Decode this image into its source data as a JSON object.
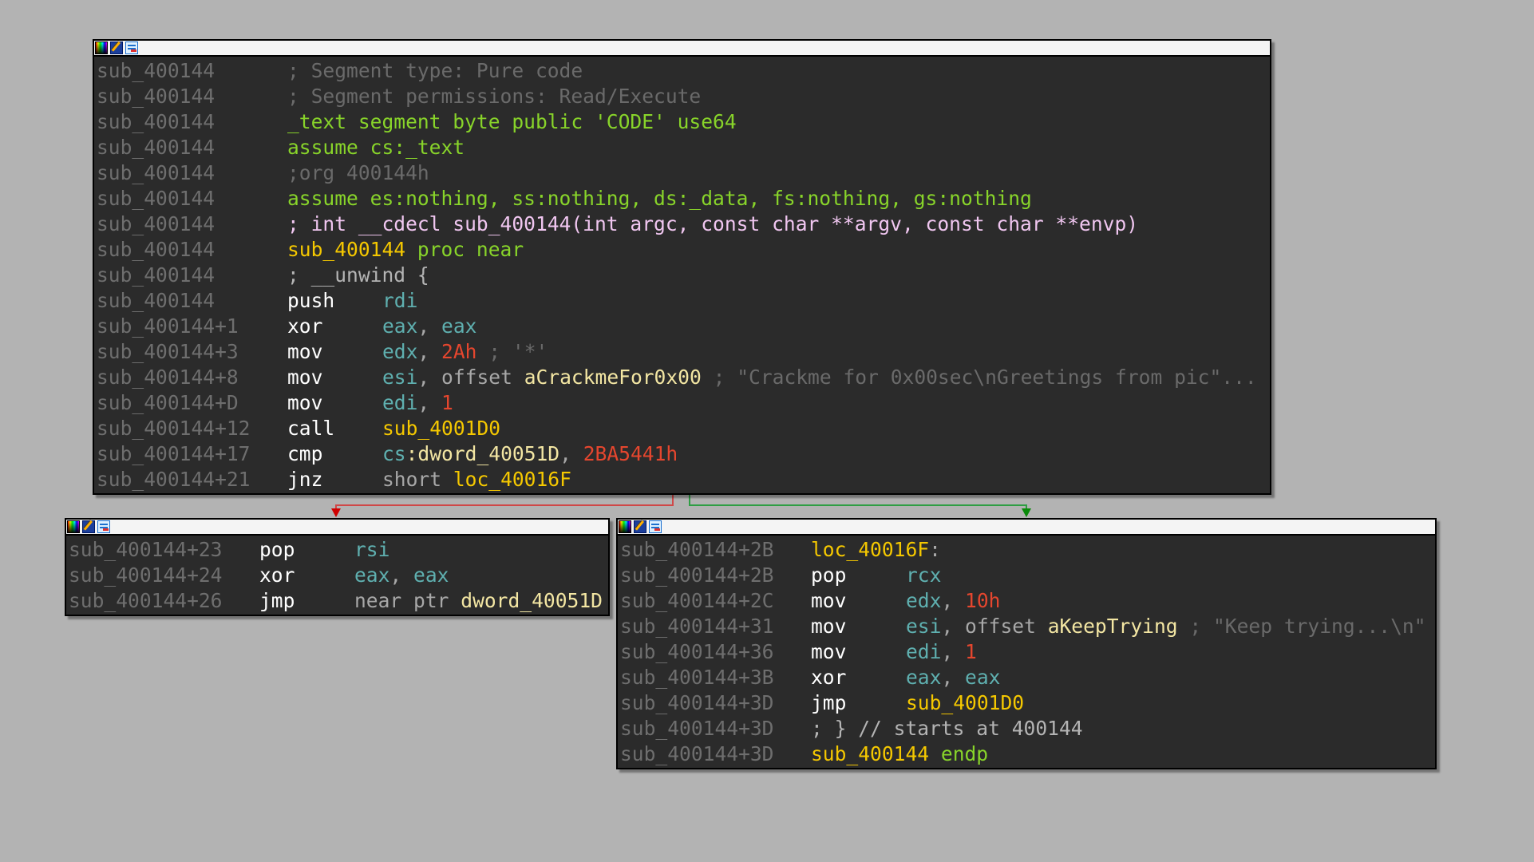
{
  "view": "IDA graph view",
  "colors": {
    "background": "#b3b3b3",
    "node_background": "#2b2b2b",
    "edge_false": "#d04848",
    "edge_true": "#2f9e44"
  },
  "node_header_icons": [
    "color-palette-icon",
    "edit-node-icon",
    "graph-view-icon"
  ],
  "nodes": {
    "main": {
      "lines": [
        {
          "addr": "sub_400144",
          "parts": [
            {
              "t": "; Segment type: Pure code",
              "c": "cmt"
            }
          ]
        },
        {
          "addr": "sub_400144",
          "parts": [
            {
              "t": "; Segment permissions: Read/Execute",
              "c": "cmt"
            }
          ]
        },
        {
          "addr": "sub_400144",
          "parts": [
            {
              "t": "_text segment byte public 'CODE' use64",
              "c": "seg"
            }
          ]
        },
        {
          "addr": "sub_400144",
          "parts": [
            {
              "t": "assume cs:_text",
              "c": "seg"
            }
          ]
        },
        {
          "addr": "sub_400144",
          "parts": [
            {
              "t": ";org 400144h",
              "c": "cmt"
            }
          ]
        },
        {
          "addr": "sub_400144",
          "parts": [
            {
              "t": "assume es:nothing, ss:nothing, ds:_data, fs:nothing, gs:nothing",
              "c": "seg"
            }
          ]
        },
        {
          "addr": "sub_400144",
          "parts": [
            {
              "t": "; int __cdecl sub_400144(int argc, const char **argv, const char **envp)",
              "c": "sig"
            }
          ]
        },
        {
          "addr": "sub_400144",
          "parts": [
            {
              "t": "sub_400144",
              "c": "lbl"
            },
            {
              "t": " proc near",
              "c": "seg"
            }
          ]
        },
        {
          "addr": "sub_400144",
          "parts": [
            {
              "t": "; __unwind {",
              "c": "lightcmt"
            }
          ]
        },
        {
          "addr": "sub_400144",
          "mnemonic": "push",
          "parts": [
            {
              "t": "rdi",
              "c": "reg"
            }
          ]
        },
        {
          "addr": "sub_400144+1",
          "mnemonic": "xor",
          "parts": [
            {
              "t": "eax",
              "c": "reg"
            },
            {
              "t": ", ",
              "c": "kw"
            },
            {
              "t": "eax",
              "c": "reg"
            }
          ]
        },
        {
          "addr": "sub_400144+3",
          "mnemonic": "mov",
          "parts": [
            {
              "t": "edx",
              "c": "reg"
            },
            {
              "t": ", ",
              "c": "kw"
            },
            {
              "t": "2Ah",
              "c": "num"
            },
            {
              "t": " ; '*'",
              "c": "cmt"
            }
          ]
        },
        {
          "addr": "sub_400144+8",
          "mnemonic": "mov",
          "parts": [
            {
              "t": "esi",
              "c": "reg"
            },
            {
              "t": ", offset ",
              "c": "kw"
            },
            {
              "t": "aCrackmeFor0x00",
              "c": "data"
            },
            {
              "t": " ; \"Crackme for 0x00sec\\nGreetings from pic\"...",
              "c": "cmt"
            }
          ]
        },
        {
          "addr": "sub_400144+D",
          "mnemonic": "mov",
          "parts": [
            {
              "t": "edi",
              "c": "reg"
            },
            {
              "t": ", ",
              "c": "kw"
            },
            {
              "t": "1",
              "c": "num"
            }
          ]
        },
        {
          "addr": "sub_400144+12",
          "mnemonic": "call",
          "parts": [
            {
              "t": "sub_4001D0",
              "c": "lbl"
            }
          ]
        },
        {
          "addr": "sub_400144+17",
          "mnemonic": "cmp",
          "parts": [
            {
              "t": "cs",
              "c": "reg"
            },
            {
              "t": ":dword_40051D",
              "c": "data"
            },
            {
              "t": ", ",
              "c": "kw"
            },
            {
              "t": "2BA5441h",
              "c": "num"
            }
          ]
        },
        {
          "addr": "sub_400144+21",
          "mnemonic": "jnz",
          "parts": [
            {
              "t": "short ",
              "c": "kw"
            },
            {
              "t": "loc_40016F",
              "c": "lbl"
            }
          ]
        }
      ]
    },
    "left": {
      "lines": [
        {
          "addr": "sub_400144+23",
          "mnemonic": "pop",
          "parts": [
            {
              "t": "rsi",
              "c": "reg"
            }
          ]
        },
        {
          "addr": "sub_400144+24",
          "mnemonic": "xor",
          "parts": [
            {
              "t": "eax",
              "c": "reg"
            },
            {
              "t": ", ",
              "c": "kw"
            },
            {
              "t": "eax",
              "c": "reg"
            }
          ]
        },
        {
          "addr": "sub_400144+26",
          "mnemonic": "jmp",
          "parts": [
            {
              "t": "near ptr ",
              "c": "kw"
            },
            {
              "t": "dword_40051D",
              "c": "data"
            }
          ]
        }
      ]
    },
    "right": {
      "lines": [
        {
          "addr": "sub_400144+2B",
          "parts": [
            {
              "t": "loc_40016F",
              "c": "lbl"
            },
            {
              "t": ":",
              "c": "kw"
            }
          ]
        },
        {
          "addr": "sub_400144+2B",
          "mnemonic": "pop",
          "parts": [
            {
              "t": "rcx",
              "c": "reg"
            }
          ]
        },
        {
          "addr": "sub_400144+2C",
          "mnemonic": "mov",
          "parts": [
            {
              "t": "edx",
              "c": "reg"
            },
            {
              "t": ", ",
              "c": "kw"
            },
            {
              "t": "10h",
              "c": "num"
            }
          ]
        },
        {
          "addr": "sub_400144+31",
          "mnemonic": "mov",
          "parts": [
            {
              "t": "esi",
              "c": "reg"
            },
            {
              "t": ", offset ",
              "c": "kw"
            },
            {
              "t": "aKeepTrying",
              "c": "data"
            },
            {
              "t": " ; \"Keep trying...\\n\"",
              "c": "cmt"
            }
          ]
        },
        {
          "addr": "sub_400144+36",
          "mnemonic": "mov",
          "parts": [
            {
              "t": "edi",
              "c": "reg"
            },
            {
              "t": ", ",
              "c": "kw"
            },
            {
              "t": "1",
              "c": "num"
            }
          ]
        },
        {
          "addr": "sub_400144+3B",
          "mnemonic": "xor",
          "parts": [
            {
              "t": "eax",
              "c": "reg"
            },
            {
              "t": ", ",
              "c": "kw"
            },
            {
              "t": "eax",
              "c": "reg"
            }
          ]
        },
        {
          "addr": "sub_400144+3D",
          "mnemonic": "jmp",
          "parts": [
            {
              "t": "sub_4001D0",
              "c": "lbl"
            }
          ]
        },
        {
          "addr": "sub_400144+3D",
          "parts": [
            {
              "t": "; } // starts at 400144",
              "c": "lightcmt"
            }
          ]
        },
        {
          "addr": "sub_400144+3D",
          "parts": [
            {
              "t": "sub_400144",
              "c": "lbl"
            },
            {
              "t": " endp",
              "c": "seg"
            }
          ]
        }
      ]
    }
  },
  "edges": [
    {
      "from": "main",
      "to": "left",
      "kind": "branch-not-taken",
      "color": "#d04848"
    },
    {
      "from": "main",
      "to": "right",
      "kind": "branch-taken",
      "color": "#2f9e44"
    }
  ]
}
